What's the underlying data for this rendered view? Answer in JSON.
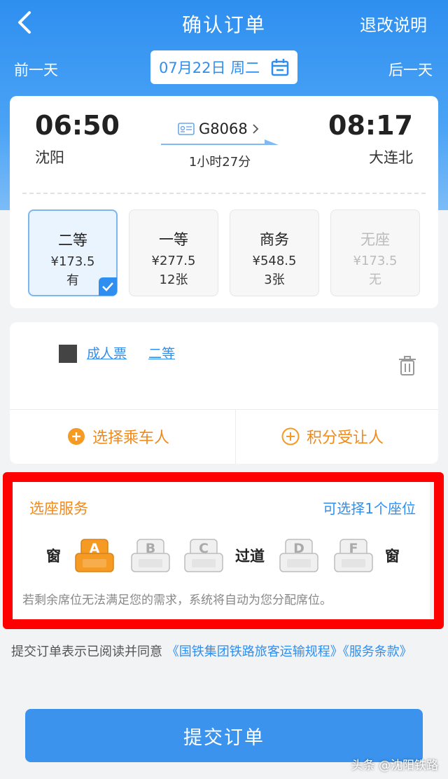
{
  "nav": {
    "title": "确认订单",
    "right_label": "退改说明"
  },
  "datebar": {
    "prev": "前一天",
    "date": "07月22日 周二",
    "next": "后一天"
  },
  "train": {
    "dep_time": "06:50",
    "dep_station": "沈阳",
    "arr_time": "08:17",
    "arr_station": "大连北",
    "number": "G8068",
    "duration": "1小时27分"
  },
  "seat_classes": [
    {
      "name": "二等",
      "price": "¥173.5",
      "count": "有"
    },
    {
      "name": "一等",
      "price": "¥277.5",
      "count": "12张"
    },
    {
      "name": "商务",
      "price": "¥548.5",
      "count": "3张"
    },
    {
      "name": "无座",
      "price": "¥173.5",
      "count": "无"
    }
  ],
  "passenger": {
    "ticket_type": "成人票",
    "seat_class": "二等"
  },
  "actions": {
    "choose_passenger": "选择乘车人",
    "points_transfer": "积分受让人"
  },
  "seat_service": {
    "title": "选座服务",
    "hint": "可选择1个座位",
    "window_label": "窗",
    "aisle_label": "过道",
    "seats": [
      "A",
      "B",
      "C",
      "D",
      "F"
    ],
    "note": "若剩余席位无法满足您的需求，系统将自动为您分配席位。"
  },
  "agreement": {
    "prefix": "提交订单表示已阅读并同意",
    "link1": "《国铁集团铁路旅客运输规程》",
    "link2": "《服务条款》"
  },
  "submit_label": "提交订单",
  "watermark": "头条 @沈阳铁路",
  "colors": {
    "primary": "#2f8ff0",
    "accent": "#f08a1c",
    "highlight": "#ff0000"
  }
}
